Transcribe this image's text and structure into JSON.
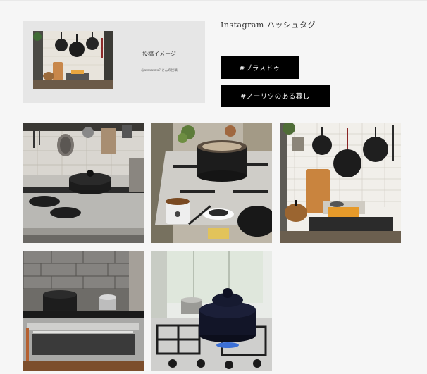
{
  "preview": {
    "label": "投稿イメージ",
    "sub_label": "@xxxxxxxx7 さんの投稿"
  },
  "section": {
    "title": "Instagram ハッシュタグ"
  },
  "hashtags": [
    {
      "label": "#プラスドゥ"
    },
    {
      "label": "#ノーリツのある暮し"
    }
  ],
  "gallery": {
    "photos": [
      {
        "subject": "kitchen-wall-pans-stove"
      },
      {
        "subject": "pot-on-stove-with-tea"
      },
      {
        "subject": "tiled-wall-pans-toast"
      },
      {
        "subject": "stone-wall-oven-range"
      },
      {
        "subject": "black-donabe-on-burner"
      }
    ]
  }
}
